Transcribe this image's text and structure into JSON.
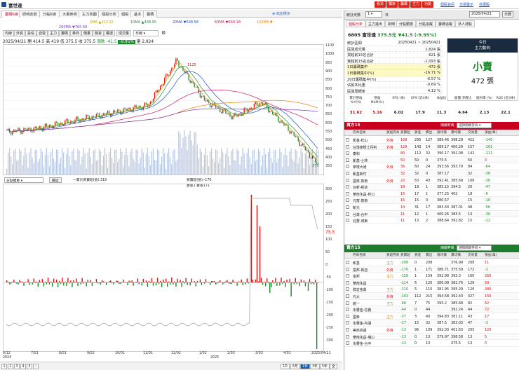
{
  "window": {
    "title": "富世達"
  },
  "top_buttons": [
    "看法",
    "獨家",
    "籌碼",
    "主力",
    "功能"
  ],
  "top_links": [
    "個股資訊",
    "交易警示",
    "自選股"
  ],
  "tabs": [
    "籌碼K線",
    "即時走勢",
    "分點K線",
    "大量券商",
    "主力地圖",
    "個股分析",
    "個股",
    "基本",
    "籌碼"
  ],
  "ma_legend": [
    {
      "label": "5MA ▲422.32",
      "color": "#c7a000"
    },
    {
      "label": "10MA ▲438.95",
      "color": "#2b8a3e"
    },
    {
      "label": "20MA ▼538.58",
      "color": "#1e50c8"
    },
    {
      "label": "60MA ▼660.18",
      "color": "#d4145a"
    },
    {
      "label": "120MA ▼",
      "color": "#f08000"
    },
    {
      "label": "200MA ▼765.69",
      "color": "#7a3cc0"
    }
  ],
  "toolbar": [
    "均線",
    "外資",
    "投信",
    "自營",
    "主力",
    "籌碼",
    "券商",
    "價量",
    "融資",
    "權證",
    "成交量"
  ],
  "period": "日線",
  "info": {
    "date": "2025/04/21",
    "open": "開 414.5",
    "high": "高 419",
    "low": "低 375.5",
    "close": "收 375.5",
    "chg_label": "漲跌",
    "chg": "-41.5",
    "pct": "-9.95%",
    "vol_label": "量",
    "vol": "2,824"
  },
  "price_axis": [
    "1100",
    "1000",
    "950",
    "900",
    "850",
    "800",
    "750",
    "700",
    "650",
    "600",
    "550",
    "500",
    "450",
    "400",
    "350"
  ],
  "high_marker": "1125",
  "low_marker": "375",
  "chart_data": {
    "type": "line",
    "title": "富世達",
    "x": [
      "6/12",
      "7/01",
      "8/01",
      "9/02",
      "10/01",
      "11/01",
      "12/02",
      "1/02",
      "2/03",
      "3/03",
      "4/01",
      "2025/04/21"
    ],
    "series": [
      {
        "name": "收盤價",
        "values": [
          600,
          620,
          660,
          700,
          740,
          780,
          1080,
          810,
          700,
          800,
          610,
          375.5
        ]
      }
    ],
    "ylim": [
      350,
      1150
    ]
  },
  "sub": {
    "select": "分點權重",
    "button": "確認",
    "legend": "一累計買賣超(張):319",
    "right_legend": "買賣超(張):-170",
    "right_legend2": "賣張1 賣張171"
  },
  "sub_axis": [
    "300",
    "250",
    "200",
    "150",
    "100",
    "50",
    "0",
    "-50",
    "-100",
    "-150",
    "-200",
    "-250",
    "-300"
  ],
  "sub_axis_marker": "75.5",
  "x_labels": [
    "6/12",
    "7/01",
    "8/01",
    "9/02",
    "10/01",
    "11/01",
    "12/02",
    "1/02",
    "2/03",
    "3/03",
    "4/01",
    "2025/04/21"
  ],
  "x_years": [
    "2024",
    "2025"
  ],
  "pager": {
    "pages": [
      "1",
      "2",
      "3",
      "4",
      "5"
    ],
    "periods": [
      "1D",
      "6月",
      "1年",
      "3年",
      "5年",
      "全"
    ]
  },
  "right": {
    "header": {
      "label": "統計天數",
      "value": "1",
      "date_label": "日",
      "date": "2025/04/21",
      "button": "日曆"
    },
    "tabs": [
      "個股分析",
      "主力進出",
      "新聞",
      "分點動態",
      "分點追蹤",
      "籌碼追蹤",
      "法人持股"
    ],
    "stock": "6805 富世達",
    "price": "375.5元",
    "chg": "▼41.5 (-9.95%)",
    "stats": [
      {
        "l": "統計區間",
        "v": "20250421 ~ 20250421"
      },
      {
        "l": "區間成交量",
        "v": "2,824 張"
      },
      {
        "l": "買超前15名合計",
        "v": "621 張"
      },
      {
        "l": "賣超前15名合計",
        "v": "-1,093 張"
      },
      {
        "l": "1日籌碼集中",
        "v": "-472 張"
      },
      {
        "l": "1日籌碼集中(%)",
        "v": "-16.71 %"
      },
      {
        "l": "20日籌碼集中(%)",
        "v": "-6.57 %"
      },
      {
        "l": "佔股本比重",
        "v": "-0.69 %"
      },
      {
        "l": "區間周轉率",
        "v": "4.12 %"
      }
    ],
    "today": {
      "head": "今日",
      "sub": "主力動向",
      "big": "小賣",
      "amount": "472 張"
    },
    "fin_heads": [
      "累計營收 YoY(%)",
      "營收 MoM(%)",
      "EPS (季)",
      "EPS (近4季)",
      "本益比",
      "股價 淨值比",
      "殖利率 (%)",
      "ROE (近4季)"
    ],
    "fin_vals": [
      "31.62",
      "5.16",
      "6.02",
      "17.9",
      "11.3",
      "4.64",
      "2.13",
      "22.1"
    ],
    "buy_title": "買方15",
    "sell_title": "賣方15",
    "filter_label": "關鍵券商:",
    "filter": "選擇關鍵券商",
    "cols": [
      "",
      "券商名稱",
      "買超券商",
      "買賣超",
      "買進",
      "賣出",
      "買均價",
      "賣均價",
      "交易量",
      "損益(萬)"
    ],
    "buy": [
      [
        "凱基-松山",
        "外資",
        "168",
        "295",
        "127",
        "389.46",
        "398.29",
        "422",
        "-149"
      ],
      [
        "台灣摩根士丹利",
        "外資",
        "129",
        "143",
        "14",
        "389.17",
        "400.29",
        "157",
        "-161"
      ],
      [
        "康和",
        "",
        "80",
        "112",
        "32",
        "390.17",
        "392.08",
        "142",
        "-111"
      ],
      [
        "凱基-士林",
        "",
        "50",
        "50",
        "0",
        "375.5",
        "",
        "50",
        "0"
      ],
      [
        "摩根大通",
        "外資",
        "36",
        "60",
        "24",
        "393.56",
        "393.79",
        "84",
        "-64"
      ],
      [
        "凱基新竹",
        "",
        "32",
        "32",
        "0",
        "387.17",
        "",
        "32",
        "-38"
      ],
      [
        "國泰-敦南",
        "外資",
        "20",
        "63",
        "43",
        "392.41",
        "385.69",
        "106",
        "-38"
      ],
      [
        "台新-新店",
        "",
        "18",
        "19",
        "1",
        "385.15",
        "394.5",
        "20",
        "-47"
      ],
      [
        "華南永昌-林口",
        "",
        "16",
        "17",
        "1",
        "377.25",
        "402",
        "18",
        "-6"
      ],
      [
        "元富-敦南",
        "",
        "15",
        "15",
        "0",
        "380.57",
        "",
        "15",
        "-10"
      ],
      [
        "新光",
        "",
        "14",
        "31",
        "17",
        "383.44",
        "387.01",
        "48",
        "-56"
      ],
      [
        "台灣-台中",
        "",
        "11",
        "12",
        "1",
        "400.26",
        "383.5",
        "13",
        "-30"
      ],
      [
        "兆豐-城東",
        "",
        "11",
        "13",
        "2",
        "388.64",
        "392.82",
        "15",
        "-22"
      ]
    ],
    "sell": [
      [
        "凱基",
        "主力",
        "-208",
        "0",
        "208",
        "",
        "376.99",
        "208",
        "11"
      ],
      [
        "富邦-新店",
        "外資",
        "-170",
        "1",
        "171",
        "386.71",
        "375.59",
        "172",
        "-2"
      ],
      [
        "富邦",
        "主力",
        "-158",
        "1",
        "159",
        "392.98",
        "393.3",
        "160",
        "266"
      ],
      [
        "華南永昌",
        "",
        "-114",
        "6",
        "120",
        "386.09",
        "382.76",
        "126",
        "59"
      ],
      [
        "群益金鼎",
        "主力",
        "-110",
        "5",
        "115",
        "381.95",
        "395.29",
        "120",
        "286"
      ],
      [
        "元大",
        "外資",
        "-103",
        "112",
        "215",
        "394.58",
        "392.43",
        "327",
        "156"
      ],
      [
        "統一",
        "主力",
        "-68",
        "7",
        "75",
        "395.2",
        "385.68",
        "82",
        "62"
      ],
      [
        "永豐金-信義",
        "",
        "-44",
        "0",
        "44",
        "",
        "392.24",
        "44",
        "72"
      ],
      [
        "國泰",
        "主力",
        "-37",
        "3",
        "40",
        "394.83",
        "381.11",
        "43",
        "17"
      ],
      [
        "永豐金-內湖",
        "",
        "-17",
        "15",
        "32",
        "387.5",
        "383.03",
        "47",
        "-3"
      ],
      [
        "美商高盛",
        "外資",
        "-13",
        "96",
        "109",
        "392.03",
        "401.63",
        "205",
        "126"
      ],
      [
        "華南永昌-埔心",
        "",
        "-13",
        "0",
        "13",
        "379.97",
        "398.58",
        "13",
        "5"
      ],
      [
        "永豐金-台中",
        "",
        "-13",
        "0",
        "13",
        "",
        "375.5",
        "13",
        "0"
      ]
    ]
  },
  "colors": {
    "up": "#d11",
    "down": "#198b2a",
    "buy_head": "#c8001e",
    "sell_head": "#1e7d2d"
  }
}
